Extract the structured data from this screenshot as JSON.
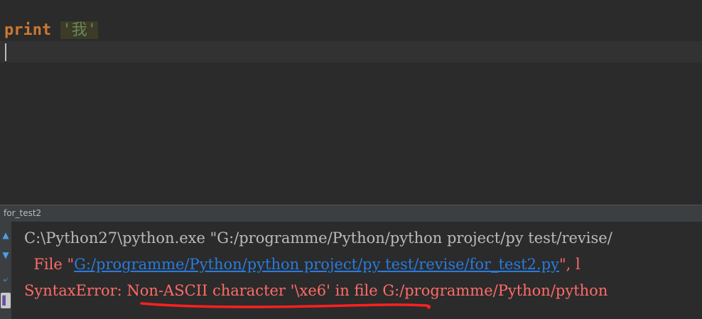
{
  "editor": {
    "keyword": "print",
    "string_literal": "'我'"
  },
  "run_panel": {
    "title": "for_test2",
    "toolbar": {
      "up_icon": "arrow-up-icon",
      "down_icon": "arrow-down-icon",
      "wrap_icon": "soft-wrap-icon",
      "mark_icon": "bookmark-icon"
    },
    "console": {
      "line1": "C:\\Python27\\python.exe \"G:/programme/Python/python project/py test/revise/",
      "line2_prefix": "File \"",
      "line2_link": "G:/programme/Python/python project/py test/revise/for_test2.py",
      "line2_suffix": "\", l",
      "line3": "SyntaxError: Non-ASCII character '\\xe6' in file G:/programme/Python/python"
    }
  },
  "colors": {
    "background": "#2b2b2b",
    "keyword": "#cc7832",
    "string": "#6a8759",
    "error": "#ff6b68",
    "link": "#287bde",
    "annotation": "#ff2020"
  }
}
